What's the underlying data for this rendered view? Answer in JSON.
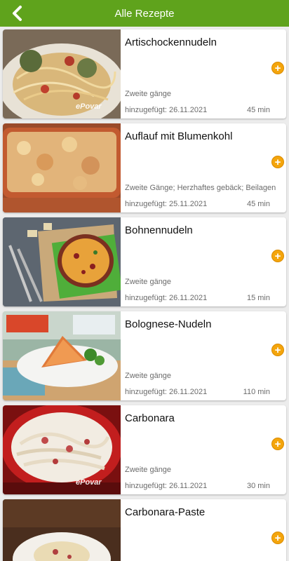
{
  "header": {
    "title": "Alle Rezepte"
  },
  "recipes": [
    {
      "title": "Artischockennudeln",
      "category": "Zweite gänge",
      "date": "hinzugefügt: 26.11.2021",
      "time": "45 min",
      "watermark": "ePovar"
    },
    {
      "title": "Auflauf mit Blumenkohl",
      "category": "Zweite Gänge; Herzhaftes gebäck; Beilagen",
      "date": "hinzugefügt: 25.11.2021",
      "time": "45 min",
      "watermark": ""
    },
    {
      "title": "Bohnennudeln",
      "category": "Zweite gänge",
      "date": "hinzugefügt: 26.11.2021",
      "time": "15 min",
      "watermark": ""
    },
    {
      "title": "Bolognese-Nudeln",
      "category": "Zweite gänge",
      "date": "hinzugefügt: 26.11.2021",
      "time": "110 min",
      "watermark": ""
    },
    {
      "title": "Carbonara",
      "category": "Zweite gänge",
      "date": "hinzugefügt: 26.11.2021",
      "time": "30 min",
      "watermark": "ePovar"
    },
    {
      "title": "Carbonara-Paste",
      "category": "",
      "date": "",
      "time": "",
      "watermark": ""
    }
  ],
  "add_label": "+"
}
